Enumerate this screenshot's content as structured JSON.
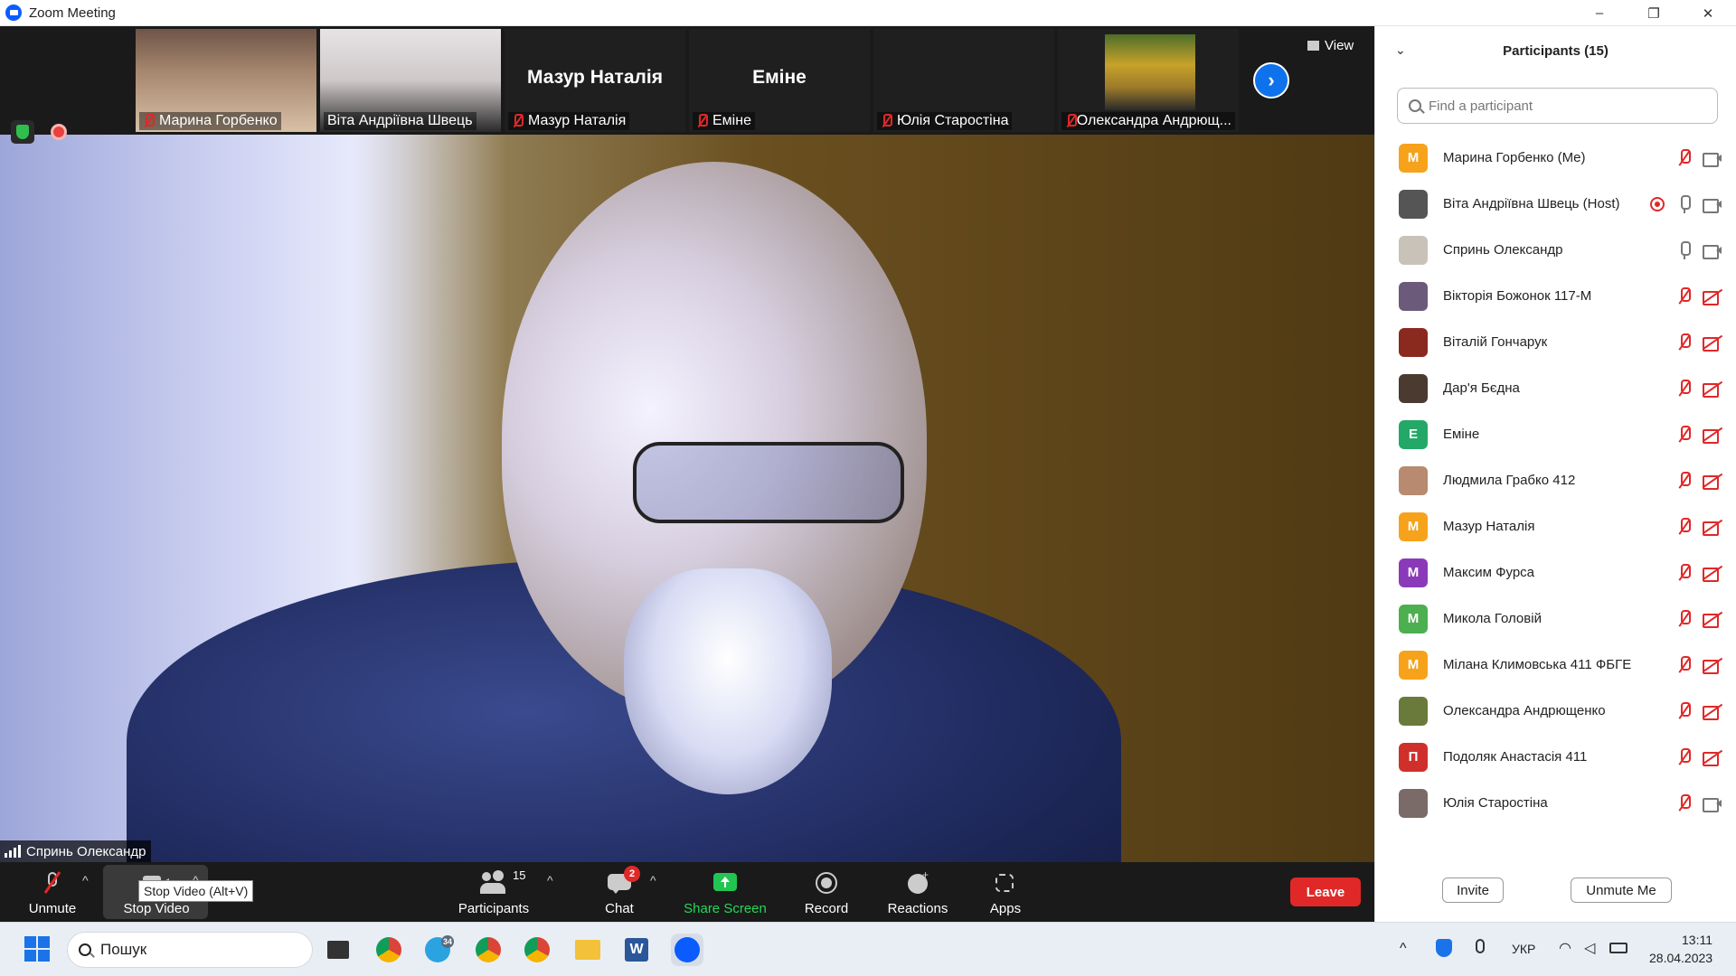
{
  "window": {
    "title": "Zoom Meeting",
    "minimize": "–",
    "maximize": "❐",
    "close": "✕"
  },
  "strip": {
    "thumbs": [
      {
        "name": "Марина Горбенко",
        "type": "photo"
      },
      {
        "name": "Віта Андріївна Швець",
        "type": "photo"
      },
      {
        "name": "Мазур Наталія",
        "big": "Мазур Наталія",
        "type": "name"
      },
      {
        "name": "Еміне",
        "big": "Еміне",
        "type": "name"
      },
      {
        "name": "Юлія Старостіна",
        "type": "blank"
      },
      {
        "name": "Олександра Андрющ...",
        "type": "photo"
      }
    ],
    "view_label": "View"
  },
  "speaker": {
    "name": "Сprинь Олександр"
  },
  "toolbar": {
    "unmute": "Unmute",
    "stop_video": "Stop Video",
    "tooltip": "Stop Video (Alt+V)",
    "participants": "Participants",
    "participants_count": "15",
    "chat": "Chat",
    "chat_badge": "2",
    "share_screen": "Share Screen",
    "record": "Record",
    "reactions": "Reactions",
    "apps": "Apps",
    "leave": "Leave"
  },
  "panel": {
    "title": "Participants (15)",
    "search_placeholder": "Find a participant",
    "participants": [
      {
        "name": "Марина Горбенко (Me)",
        "initial": "М",
        "color": "#f7a21b",
        "mic": "off",
        "cam": "on",
        "rec": false
      },
      {
        "name": "Віта Андріївна Швець (Host)",
        "initial": "",
        "color": "#555555",
        "mic": "on",
        "cam": "on",
        "rec": true
      },
      {
        "name": "Спринь Олександр",
        "initial": "",
        "color": "#c8c2b8",
        "mic": "on",
        "cam": "on",
        "rec": false
      },
      {
        "name": "Вікторія Божонок 117-М",
        "initial": "",
        "color": "#6b5a7a",
        "mic": "off",
        "cam": "off",
        "rec": false
      },
      {
        "name": "Віталій Гончарук",
        "initial": "",
        "color": "#8a2a1e",
        "mic": "off",
        "cam": "off",
        "rec": false
      },
      {
        "name": "Дар'я Бєдна",
        "initial": "",
        "color": "#4a3a30",
        "mic": "off",
        "cam": "off",
        "rec": false
      },
      {
        "name": "Еміне",
        "initial": "E",
        "color": "#23a868",
        "mic": "off",
        "cam": "off",
        "rec": false
      },
      {
        "name": "Людмила Грабко  412",
        "initial": "",
        "color": "#b88a70",
        "mic": "off",
        "cam": "off",
        "rec": false
      },
      {
        "name": "Мазур Наталія",
        "initial": "М",
        "color": "#f7a21b",
        "mic": "off",
        "cam": "off",
        "rec": false
      },
      {
        "name": "Максим Фурса",
        "initial": "М",
        "color": "#8a3ab9",
        "mic": "off",
        "cam": "off",
        "rec": false
      },
      {
        "name": "Микола Головій",
        "initial": "M",
        "color": "#4caf50",
        "mic": "off",
        "cam": "off",
        "rec": false
      },
      {
        "name": "Мілана Климовська 411 ФБГЕ",
        "initial": "М",
        "color": "#f7a21b",
        "mic": "off",
        "cam": "off",
        "rec": false
      },
      {
        "name": "Олександра Андрющенко",
        "initial": "",
        "color": "#6a7a3a",
        "mic": "off",
        "cam": "off",
        "rec": false
      },
      {
        "name": "Подоляк Анастасія 411",
        "initial": "П",
        "color": "#d0302c",
        "mic": "off",
        "cam": "off",
        "rec": false
      },
      {
        "name": "Юлія Старостіна",
        "initial": "",
        "color": "#7a6a68",
        "mic": "off",
        "cam": "on",
        "rec": false
      }
    ],
    "invite": "Invite",
    "unmute_me": "Unmute Me"
  },
  "taskbar": {
    "search": "Пошук",
    "telegram_badge": "34",
    "lang": "УКР",
    "time": "13:11",
    "date": "28.04.2023"
  }
}
